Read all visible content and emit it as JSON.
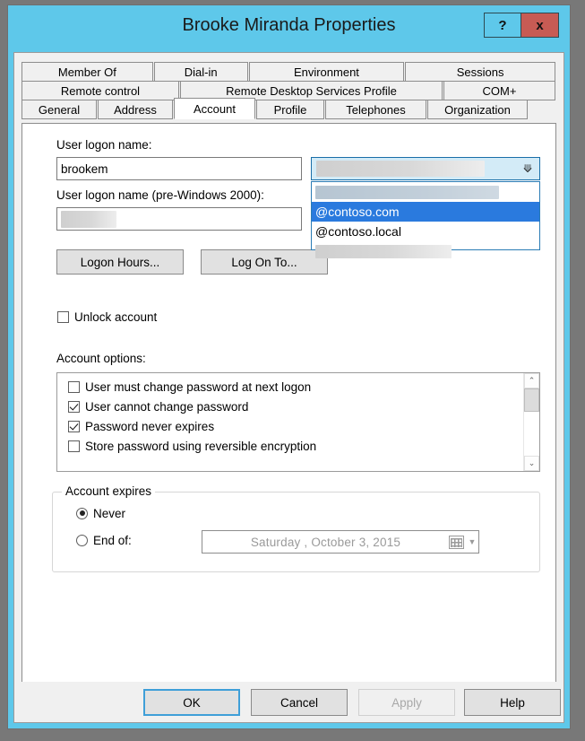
{
  "window": {
    "title": "Brooke Miranda Properties",
    "help_button": "?",
    "close_button": "x",
    "titlebar_color": "#5ec8ea",
    "close_color": "#c75b54"
  },
  "tabs": {
    "row1": [
      {
        "label": "Member Of",
        "active": false
      },
      {
        "label": "Dial-in",
        "active": false
      },
      {
        "label": "Environment",
        "active": false
      },
      {
        "label": "Sessions",
        "active": false
      }
    ],
    "row2": [
      {
        "label": "Remote control",
        "active": false
      },
      {
        "label": "Remote Desktop Services Profile",
        "active": false
      },
      {
        "label": "COM+",
        "active": false
      }
    ],
    "row3": [
      {
        "label": "General",
        "active": false
      },
      {
        "label": "Address",
        "active": false
      },
      {
        "label": "Account",
        "active": true
      },
      {
        "label": "Profile",
        "active": false
      },
      {
        "label": "Telephones",
        "active": false
      },
      {
        "label": "Organization",
        "active": false
      }
    ]
  },
  "account": {
    "logon_name_label": "User logon name:",
    "logon_name_value": "brookem",
    "pre2000_label": "User logon name (pre-Windows 2000):",
    "pre2000_value": "",
    "domain_combo": {
      "selected": "",
      "expanded": true,
      "options": [
        {
          "label": "",
          "redacted": true,
          "selected": false
        },
        {
          "label": "@contoso.com",
          "redacted": false,
          "selected": true
        },
        {
          "label": "@contoso.local",
          "redacted": false,
          "selected": false
        },
        {
          "label": "",
          "redacted": true,
          "selected": false
        }
      ]
    },
    "logon_hours_button": "Logon Hours...",
    "log_on_to_button": "Log On To...",
    "unlock_account": {
      "label": "Unlock account",
      "checked": false
    },
    "options_label": "Account options:",
    "options": [
      {
        "label": "User must change password at next logon",
        "checked": false
      },
      {
        "label": "User cannot change password",
        "checked": true
      },
      {
        "label": "Password never expires",
        "checked": true
      },
      {
        "label": "Store password using reversible encryption",
        "checked": false
      }
    ],
    "scroll": {
      "up_arrow": "⌃",
      "down_arrow": "⌄"
    },
    "expires": {
      "legend": "Account expires",
      "never": {
        "label": "Never",
        "selected": true
      },
      "end_of": {
        "label": "End of:",
        "selected": false
      },
      "date_value": "Saturday    ,   October      3, 2015",
      "date_enabled": false,
      "dropdown_arrow": "▼"
    }
  },
  "footer": {
    "buttons": [
      {
        "label": "OK",
        "default": true,
        "disabled": false
      },
      {
        "label": "Cancel",
        "default": false,
        "disabled": false
      },
      {
        "label": "Apply",
        "default": false,
        "disabled": true
      },
      {
        "label": "Help",
        "default": false,
        "disabled": false
      }
    ]
  }
}
